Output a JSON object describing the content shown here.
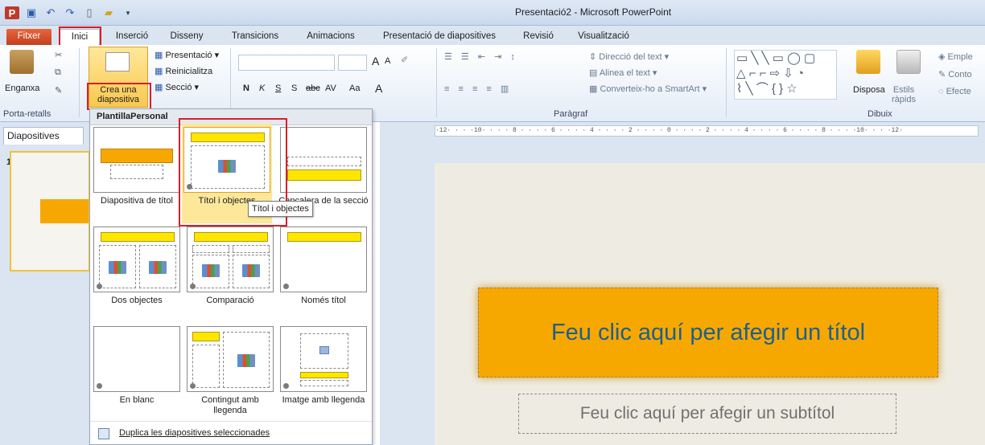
{
  "window": {
    "title": "Presentació2 - Microsoft PowerPoint"
  },
  "qat": {
    "app_icon": "P"
  },
  "tabs": [
    "Fitxer",
    "Inici",
    "Inserció",
    "Disseny",
    "Transicions",
    "Animacions",
    "Presentació de diapositives",
    "Revisió",
    "Visualització"
  ],
  "ribbon": {
    "clipboard": {
      "paste": "Enganxa",
      "label": "Porta-retalls"
    },
    "slides": {
      "new_slide_1": "Crea una",
      "new_slide_2": "diapositiva",
      "layout": "Presentació",
      "reset": "Reinicialitza",
      "section": "Secció"
    },
    "font": {
      "grow": "A",
      "shrink": "A",
      "bold": "N",
      "italic": "K",
      "underline": "S",
      "shadow": "S",
      "strike": "abc",
      "spacing": "AV",
      "case": "Aa",
      "color": "A"
    },
    "paragraph": {
      "text_direction": "Direcció del text",
      "align_text": "Alinea el text",
      "smartart": "Converteix-ho a SmartArt",
      "label": "Paràgraf"
    },
    "drawing": {
      "arrange": "Disposa",
      "quick_styles_1": "Estils",
      "quick_styles_2": "ràpids",
      "fill": "Emple",
      "outline": "Conto",
      "effects": "Efecte",
      "label": "Dibuix"
    }
  },
  "left_panel": {
    "tab": "Diapositives",
    "slide_number": "1"
  },
  "ruler": "·12· · · ·10· · · · 8 · · · · 6 · · · · 4 · · · · 2 · · · · 0 · · · · 2 · · · · 4 · · · · 6 · · · · 8 · · · ·10· · · ·12·",
  "slide": {
    "title": "Feu clic aquí per afegir un títol",
    "subtitle": "Feu clic aquí per afegir un subtítol"
  },
  "gallery": {
    "header": "PlantillaPersonal",
    "layouts": [
      "Diapositiva de títol",
      "Títol i objectes",
      "Capçalera de la secció",
      "Dos objectes",
      "Comparació",
      "Només títol",
      "En blanc",
      "Contingut amb llegenda",
      "Imatge amb llegenda"
    ],
    "tooltip": "Títol i objectes",
    "footer": "Duplica les diapositives seleccionades"
  }
}
